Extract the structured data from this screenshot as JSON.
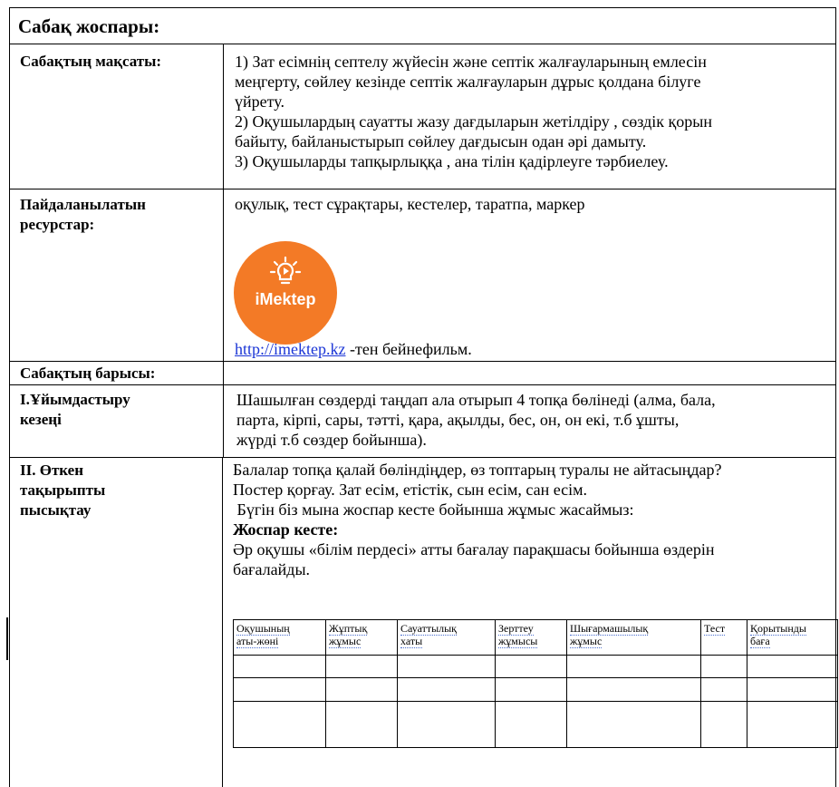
{
  "title": "Сабақ жоспары:",
  "objectives": {
    "label": "Сабақтың мақсаты:",
    "lines": [
      "1) Зат есімнің септелу жүйесін және септік жалғауларының емлесін",
      "меңгерту, сөйлеу кезінде септік жалғауларын дұрыс қолдана білуге",
      "үйрету.",
      "2) Оқушылардың сауатты жазу дағдыларын жетілдіру , сөздік қорын",
      "байыту, байланыстырып сөйлеу дағдысын одан әрі дамыту.",
      "3) Оқушыларды тапқырлыққа , ана тілін қадірлеуге тәрбиелеу."
    ]
  },
  "resources": {
    "label_lines": [
      "Пайдаланылатын",
      "ресурстар:"
    ],
    "text": "оқулық,  тест сұрақтары, кестелер, таратпа, маркер",
    "logo_text": "iMektep",
    "link": "http://imektep.kz",
    "link_suffix": " -тен бейнефильм."
  },
  "progress": {
    "label": "Сабақтың барысы:"
  },
  "organization": {
    "label_lines": [
      "I.Ұйымдастыру",
      "кезеңі"
    ],
    "lines": [
      "Шашылған сөздерді таңдап ала отырып 4 топқа бөлінеді (алма, бала,",
      "парта, кірпі, сары, тәтті, қара, ақылды, бес, он, он екі, т.б ұшты,",
      "жүрді т.б  сөздер бойынша)."
    ]
  },
  "review": {
    "label_lines": [
      "II. Өткен",
      "тақырыпты",
      "пысықтау"
    ],
    "lines": [
      "Балалар топқа қалай бөліндіңдер, өз топтарың туралы не айтасыңдар?",
      "Постер қорғау. Зат есім, етістік, сын есім, сан есім.",
      " Бүгін біз мына жоспар кесте бойынша жұмыс жасаймыз:"
    ],
    "plan_heading": "Жоспар кесте:",
    "assessment_lines": [
      "Әр оқушы «білім пердесі» атты бағалау парақшасы бойынша өздерін",
      "бағалайды."
    ],
    "table_headers": [
      [
        "Оқушының",
        "аты-жөні"
      ],
      [
        "Жұптық",
        "жұмыс"
      ],
      [
        "Сауаттылық",
        "хаты"
      ],
      [
        "Зерттеу",
        "жұмысы"
      ],
      [
        "Шығармашылық",
        "жұмыс"
      ],
      [
        "Тест",
        ""
      ],
      [
        "Қорытынды",
        "баға"
      ]
    ]
  }
}
